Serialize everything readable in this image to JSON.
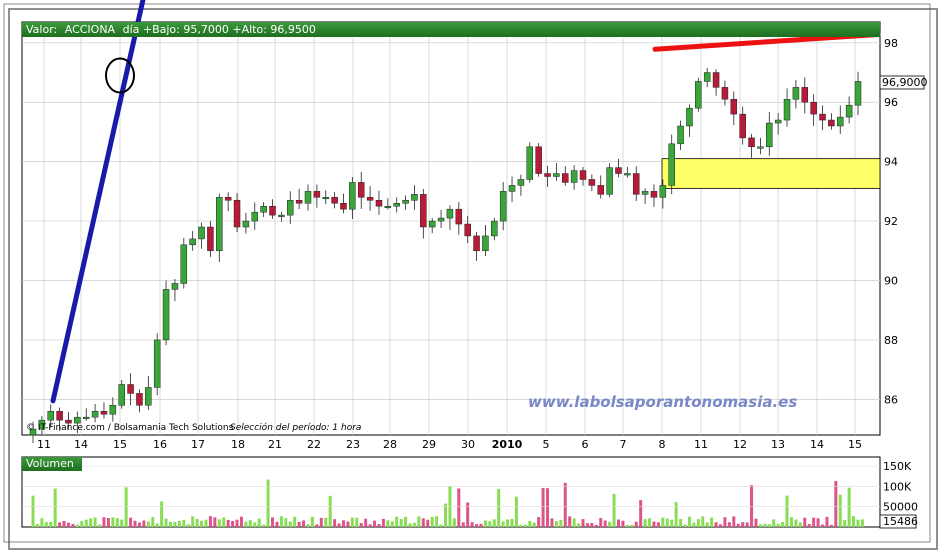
{
  "header": {
    "label_prefix": "Valor:",
    "instrument": "ACCIONA",
    "quote": "día +Bajo: 95,7000 +Alto: 96,9500"
  },
  "copyright": "© IT-Finance.com / Bolsamania Tech Solutions",
  "period": "Selección del período: 1 hora",
  "watermark": "www.labolsaporantonomasia.es",
  "price_badge": "96,9000",
  "volume_label": "Volumen",
  "volume_badge": "15486",
  "colors": {
    "up": "#3aa63a",
    "down": "#b81a3a",
    "support": "#1a1aaa",
    "resistance": "#ee1111",
    "zone": "#ffff66",
    "volume_up": "#88dd55",
    "volume_down": "#dd5588"
  },
  "chart_data": [
    {
      "type": "candlestick",
      "title": "",
      "x_tick_labels": [
        "11",
        "14",
        "15",
        "16",
        "17",
        "18",
        "21",
        "22",
        "23",
        "28",
        "29",
        "30",
        "2010",
        "5",
        "6",
        "7",
        "8",
        "11",
        "12",
        "13",
        "14",
        "15"
      ],
      "y_ticks": [
        86,
        88,
        90,
        92,
        94,
        96,
        98
      ],
      "ylim": [
        84.8,
        98.7
      ],
      "grid": true,
      "close_path": [
        85.0,
        85.3,
        85.6,
        85.3,
        85.2,
        85.4,
        85.4,
        85.6,
        85.5,
        85.8,
        86.5,
        86.2,
        85.8,
        86.4,
        88.0,
        89.7,
        89.9,
        91.2,
        91.4,
        91.8,
        91.0,
        92.8,
        92.7,
        91.8,
        92.0,
        92.3,
        92.5,
        92.2,
        92.2,
        92.7,
        92.6,
        93.0,
        92.8,
        92.8,
        92.6,
        92.4,
        93.3,
        92.8,
        92.7,
        92.5,
        92.5,
        92.6,
        92.7,
        92.9,
        91.8,
        92.0,
        92.1,
        92.4,
        91.9,
        91.5,
        91.0,
        91.5,
        92.0,
        93.0,
        93.2,
        93.4,
        94.5,
        93.6,
        93.5,
        93.6,
        93.3,
        93.7,
        93.4,
        93.2,
        92.9,
        93.8,
        93.6,
        93.6,
        92.9,
        93.0,
        92.8,
        93.2,
        94.6,
        95.2,
        95.8,
        96.7,
        97.0,
        96.5,
        96.1,
        95.6,
        94.8,
        94.5,
        94.5,
        95.3,
        95.4,
        96.1,
        96.5,
        96.0,
        95.6,
        95.4,
        95.2,
        95.5,
        95.9,
        96.7
      ],
      "annotations": [
        {
          "kind": "trendline",
          "name": "support",
          "from": [
            "11",
            84.6
          ],
          "to": [
            "15",
            96.0
          ]
        },
        {
          "kind": "trendline",
          "name": "resistance",
          "from": [
            "8",
            97.8
          ],
          "to": [
            "15",
            96.6
          ]
        },
        {
          "kind": "zone",
          "y": [
            93.1,
            94.1
          ],
          "from": "8",
          "to": "end"
        },
        {
          "kind": "circle",
          "at": [
            "15",
            96.9
          ]
        }
      ]
    },
    {
      "type": "bar",
      "title": "Volumen",
      "y_ticks": [
        "50000",
        "100K",
        "150K"
      ],
      "ylim": [
        0,
        170000
      ]
    }
  ]
}
